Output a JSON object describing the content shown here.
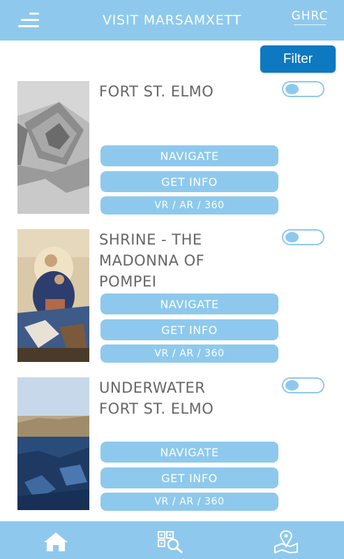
{
  "header": {
    "title": "VISIT MARSAMXETT",
    "logo_text": "GHRC",
    "menu_icon": "hamburger-menu-icon"
  },
  "filter_label": "Filter",
  "sites": [
    {
      "title": "FORT ST. ELMO",
      "toggle_on": false,
      "navigate_label": "NAVIGATE",
      "info_label": "GET INFO",
      "vr_label": "VR / AR / 360"
    },
    {
      "title": "SHRINE - THE\nMADONNA OF\nPOMPEI",
      "toggle_on": false,
      "navigate_label": "NAVIGATE",
      "info_label": "GET INFO",
      "vr_label": "VR / AR / 360"
    },
    {
      "title": "UNDERWATER\nFORT ST. ELMO",
      "toggle_on": false,
      "navigate_label": "NAVIGATE",
      "info_label": "GET INFO",
      "vr_label": "VR / AR / 360"
    }
  ],
  "tabs": [
    {
      "icon": "home-icon"
    },
    {
      "icon": "qr-scan-icon"
    },
    {
      "icon": "map-pin-icon"
    }
  ],
  "colors": {
    "accent": "#8ec9ed",
    "primary_button": "#0d79c0",
    "title_text": "#666666"
  }
}
